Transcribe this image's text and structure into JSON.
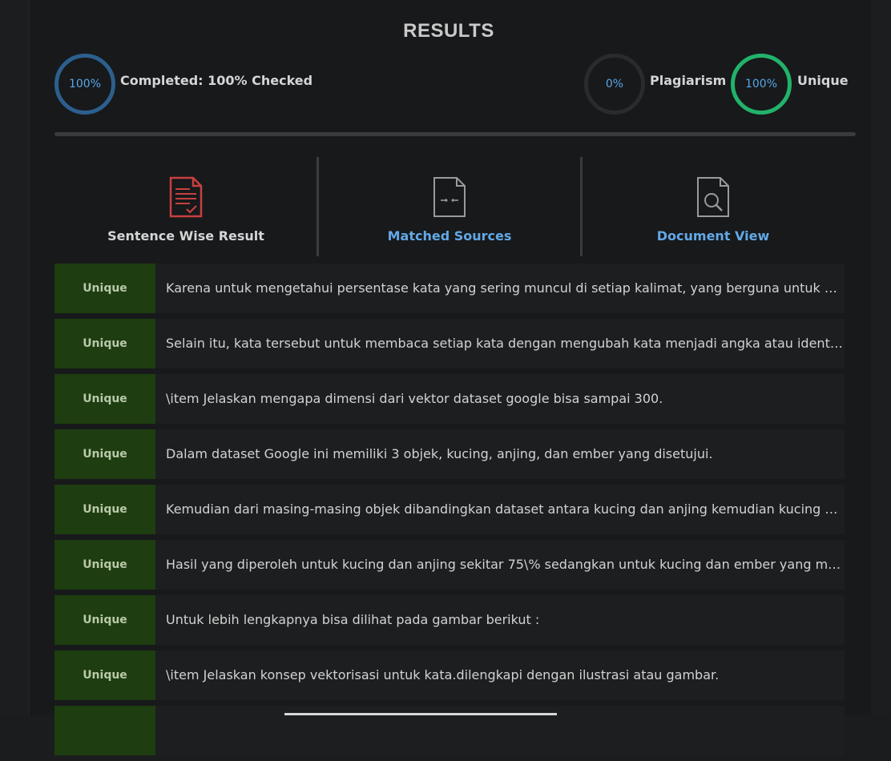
{
  "header": {
    "title": "RESULTS"
  },
  "stats": {
    "completed_percent": "100%",
    "completed_label": "Completed: 100% Checked",
    "plagiarism_percent": "0%",
    "plagiarism_label": "Plagiarism",
    "unique_percent": "100%",
    "unique_label": "Unique"
  },
  "tabs": [
    {
      "label": "Sentence Wise Result",
      "icon": "document-check-icon",
      "active": true
    },
    {
      "label": "Matched Sources",
      "icon": "document-compare-icon",
      "active": false
    },
    {
      "label": "Document View",
      "icon": "document-search-icon",
      "active": false
    }
  ],
  "colors": {
    "unique_badge": "#1e3d10",
    "completed_ring": "#2c5f8e",
    "unique_ring": "#21b36a",
    "link_blue": "#63a8e6",
    "icon_red": "#c8403f"
  },
  "results": [
    {
      "status": "Unique",
      "text": "Karena untuk mengetahui persentase kata yang sering muncul di setiap kalimat, yang berguna untuk mengukur kemiripan antar dokumen."
    },
    {
      "status": "Unique",
      "text": "Selain itu, kata tersebut untuk membaca setiap kata dengan mengubah kata menjadi angka atau identitas numerik."
    },
    {
      "status": "Unique",
      "text": "\\item Jelaskan mengapa dimensi dari vektor dataset google bisa sampai 300."
    },
    {
      "status": "Unique",
      "text": "Dalam dataset Google ini memiliki 3 objek, kucing, anjing, dan ember yang disetujui."
    },
    {
      "status": "Unique",
      "text": "Kemudian dari masing-masing objek dibandingkan dataset antara kucing dan anjing kemudian kucing dan ember."
    },
    {
      "status": "Unique",
      "text": "Hasil yang diperoleh untuk kucing dan anjing sekitar 75\\% sedangkan untuk kucing dan ember yang memiliki nilai lebih kecil."
    },
    {
      "status": "Unique",
      "text": "Untuk lebih lengkapnya bisa dilihat pada gambar berikut :"
    },
    {
      "status": "Unique",
      "text": "\\item Jelaskan konsep vektorisasi untuk kata.dilengkapi dengan ilustrasi atau gambar."
    }
  ]
}
